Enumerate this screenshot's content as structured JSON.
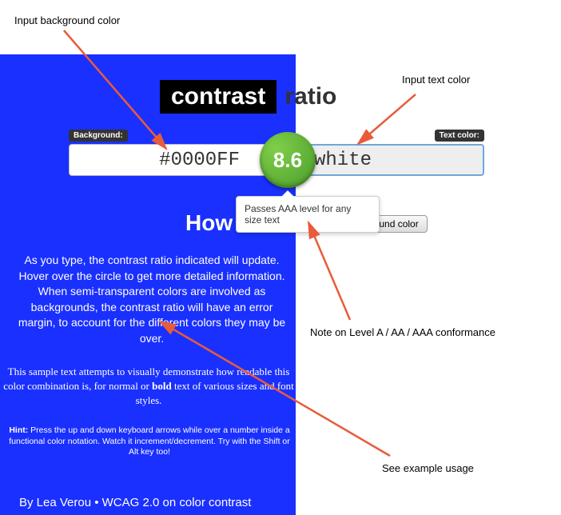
{
  "title": {
    "contrast": "contrast",
    "ratio": "ratio"
  },
  "labels": {
    "background": "Background:",
    "textcolor": "Text color:"
  },
  "inputs": {
    "bg_value": "#0000FF",
    "text_value": "white"
  },
  "ratio": "8.6",
  "tooltip": "Passes AAA level for any size text",
  "swap_button": "ground color",
  "how_heading": "How",
  "description": "As you type, the contrast ratio indicated will update. Hover over the circle to get more detailed information. When semi-transparent colors are involved as backgrounds, the contrast ratio will have an error margin, to account for the different colors they may be over.",
  "sample": {
    "prefix": "This sample text attempts to visually demonstrate how readable this color combination is, for normal or ",
    "bold": "bold",
    "suffix": " text of various sizes and font styles."
  },
  "hint": {
    "label": "Hint:",
    "text": " Press the up and down keyboard arrows while over a number inside a functional color notation. Watch it increment/decrement. Try with the Shift or Alt key too!"
  },
  "byline": "By Lea Verou • WCAG 2.0 on color contrast",
  "annotations": {
    "bg": "Input background color",
    "tx": "Input text color",
    "conformance": "Note on Level A / AA / AAA conformance",
    "example": "See example usage"
  }
}
